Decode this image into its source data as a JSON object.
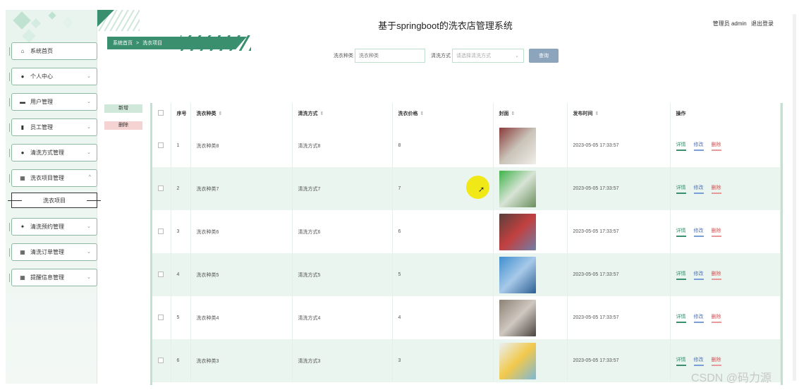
{
  "app": {
    "title": "基于springboot的洗衣店管理系统",
    "user_label": "管理员 admin",
    "logout_label": "退出登录"
  },
  "sidebar": {
    "items": [
      {
        "label": "系统首页",
        "icon": "home-icon",
        "glyph": "⌂",
        "has_chevron": false
      },
      {
        "label": "个人中心",
        "icon": "user-icon",
        "glyph": "●",
        "has_chevron": true
      },
      {
        "label": "用户管理",
        "icon": "users-icon",
        "glyph": "▬",
        "has_chevron": true
      },
      {
        "label": "员工管理",
        "icon": "staff-icon",
        "glyph": "▮",
        "has_chevron": true
      },
      {
        "label": "清洗方式管理",
        "icon": "user-icon",
        "glyph": "●",
        "has_chevron": true
      },
      {
        "label": "洗衣项目管理",
        "icon": "grid-icon",
        "glyph": "▦",
        "has_chevron": true,
        "open": true
      },
      {
        "label": "清洗预约管理",
        "icon": "thumb-icon",
        "glyph": "✦",
        "has_chevron": true
      },
      {
        "label": "清洗订单管理",
        "icon": "grid-icon",
        "glyph": "▦",
        "has_chevron": true
      },
      {
        "label": "提醒信息管理",
        "icon": "grid-icon",
        "glyph": "▦",
        "has_chevron": true
      }
    ],
    "submenu_label": "洗衣项目"
  },
  "breadcrumb": {
    "root": "系统首页",
    "sep": ">",
    "current": "洗衣项目"
  },
  "search": {
    "kind_label": "洗衣种类",
    "kind_placeholder": "洗衣种类",
    "method_label": "清洗方式",
    "method_placeholder": "请选择清洗方式",
    "query_button": "查询"
  },
  "actions": {
    "add": "新增",
    "delete": "删除"
  },
  "table": {
    "headers": [
      "序号",
      "洗衣种类",
      "清洗方式",
      "洗衣价格",
      "封面",
      "发布时间",
      "操作"
    ],
    "ops": {
      "detail": "详情",
      "edit": "修改",
      "delete": "删除"
    },
    "rows": [
      {
        "no": "1",
        "kind": "洗衣种类8",
        "method": "清洗方式8",
        "price": "8",
        "time": "2023-05-05 17:33:57",
        "cover": [
          "#8a3b3b",
          "#c9c3b8",
          "#f0eee8"
        ]
      },
      {
        "no": "2",
        "kind": "洗衣种类7",
        "method": "清洗方式7",
        "price": "7",
        "time": "2023-05-05 17:33:57",
        "cover": [
          "#3fb34a",
          "#d8e4d6",
          "#6a8f5c"
        ]
      },
      {
        "no": "3",
        "kind": "洗衣种类6",
        "method": "清洗方式6",
        "price": "6",
        "time": "2023-05-05 17:33:57",
        "cover": [
          "#5a3f3a",
          "#c24040",
          "#6f7fa8"
        ]
      },
      {
        "no": "4",
        "kind": "洗衣种类5",
        "method": "清洗方式5",
        "price": "5",
        "time": "2023-05-05 17:33:57",
        "cover": [
          "#3f8fd0",
          "#a7c9e8",
          "#2d5f94"
        ]
      },
      {
        "no": "5",
        "kind": "洗衣种类4",
        "method": "清洗方式4",
        "price": "4",
        "time": "2023-05-05 17:33:57",
        "cover": [
          "#8c8276",
          "#cfc8c0",
          "#4a4340"
        ]
      },
      {
        "no": "6",
        "kind": "洗衣种类3",
        "method": "清洗方式3",
        "price": "3",
        "time": "2023-05-05 17:33:57",
        "cover": [
          "#e8f0f4",
          "#f2c94c",
          "#7bb8d8"
        ]
      }
    ]
  },
  "watermark": "CSDN @码力源"
}
